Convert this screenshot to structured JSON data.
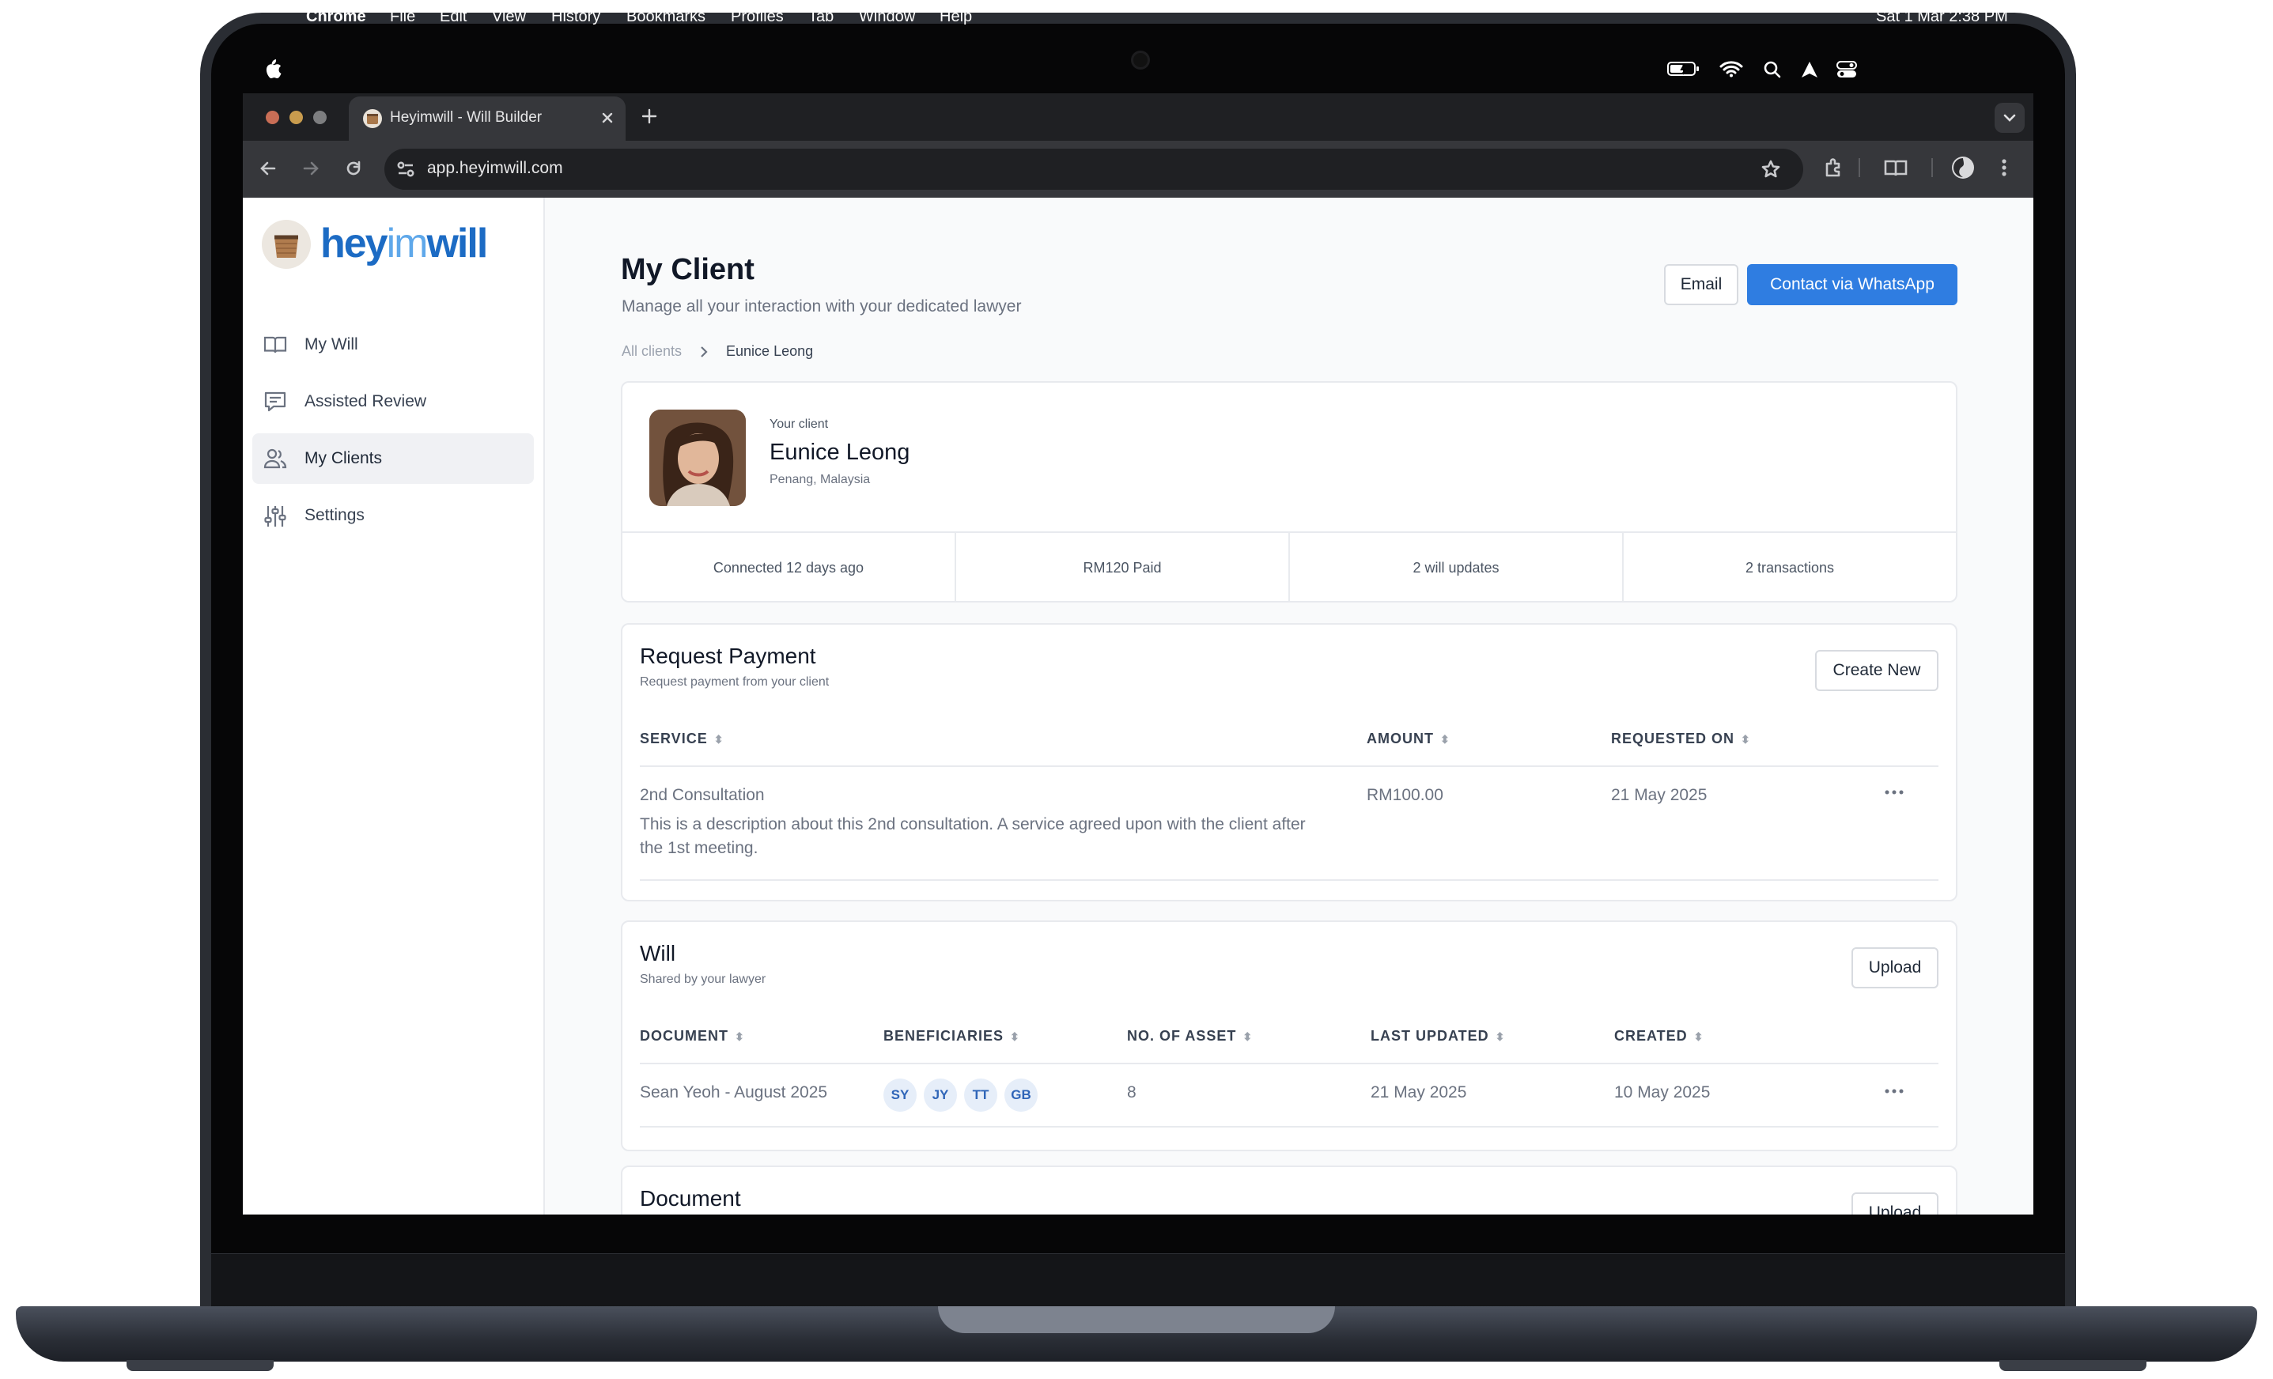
{
  "menubar": {
    "app": "Chrome",
    "items": [
      "File",
      "Edit",
      "View",
      "History",
      "Bookmarks",
      "Profiles",
      "Tab",
      "Window",
      "Help"
    ],
    "clock": "Sat 1 Mar  2:38 PM"
  },
  "browser": {
    "tab_title": "Heyimwill - Will Builder",
    "url": "app.heyimwill.com"
  },
  "sidebar": {
    "logo_hey": "hey",
    "logo_im": "im",
    "logo_will": "will",
    "items": [
      {
        "label": "My Will"
      },
      {
        "label": "Assisted Review"
      },
      {
        "label": "My Clients",
        "active": true
      },
      {
        "label": "Settings"
      }
    ]
  },
  "header": {
    "title": "My Client",
    "subtitle": "Manage all your interaction with your dedicated lawyer",
    "email_btn": "Email",
    "whatsapp_btn": "Contact via WhatsApp",
    "breadcrumb_root": "All clients",
    "breadcrumb_current": "Eunice Leong"
  },
  "client": {
    "caption": "Your client",
    "name": "Eunice Leong",
    "location": "Penang, Malaysia",
    "stats": [
      "Connected 12 days ago",
      "RM120 Paid",
      "2 will updates",
      "2 transactions"
    ]
  },
  "payment": {
    "title": "Request Payment",
    "subtitle": "Request payment from your client",
    "create_btn": "Create New",
    "columns": [
      "SERVICE",
      "AMOUNT",
      "REQUESTED ON"
    ],
    "rows": [
      {
        "service": "2nd Consultation",
        "description": "This is a description about this 2nd consultation. A service agreed upon with the client after the 1st meeting.",
        "amount": "RM100.00",
        "requested_on": "21 May 2025"
      }
    ]
  },
  "will": {
    "title": "Will",
    "subtitle": "Shared by your lawyer",
    "upload_btn": "Upload",
    "columns": [
      "DOCUMENT",
      "BENEFICIARIES",
      "NO. OF ASSET",
      "LAST UPDATED",
      "CREATED"
    ],
    "rows": [
      {
        "document": "Sean Yeoh - August 2025",
        "beneficiaries": [
          "SY",
          "JY",
          "TT",
          "GB"
        ],
        "assets": "8",
        "last_updated": "21 May 2025",
        "created": "10 May 2025"
      }
    ]
  },
  "documents": {
    "title": "Document",
    "upload_btn": "Upload"
  },
  "colors": {
    "brand_blue": "#2f7de1",
    "logo_blue": "#1c6bc4",
    "chip_bg": "#e6eef9",
    "chip_text": "#2f65b8"
  }
}
